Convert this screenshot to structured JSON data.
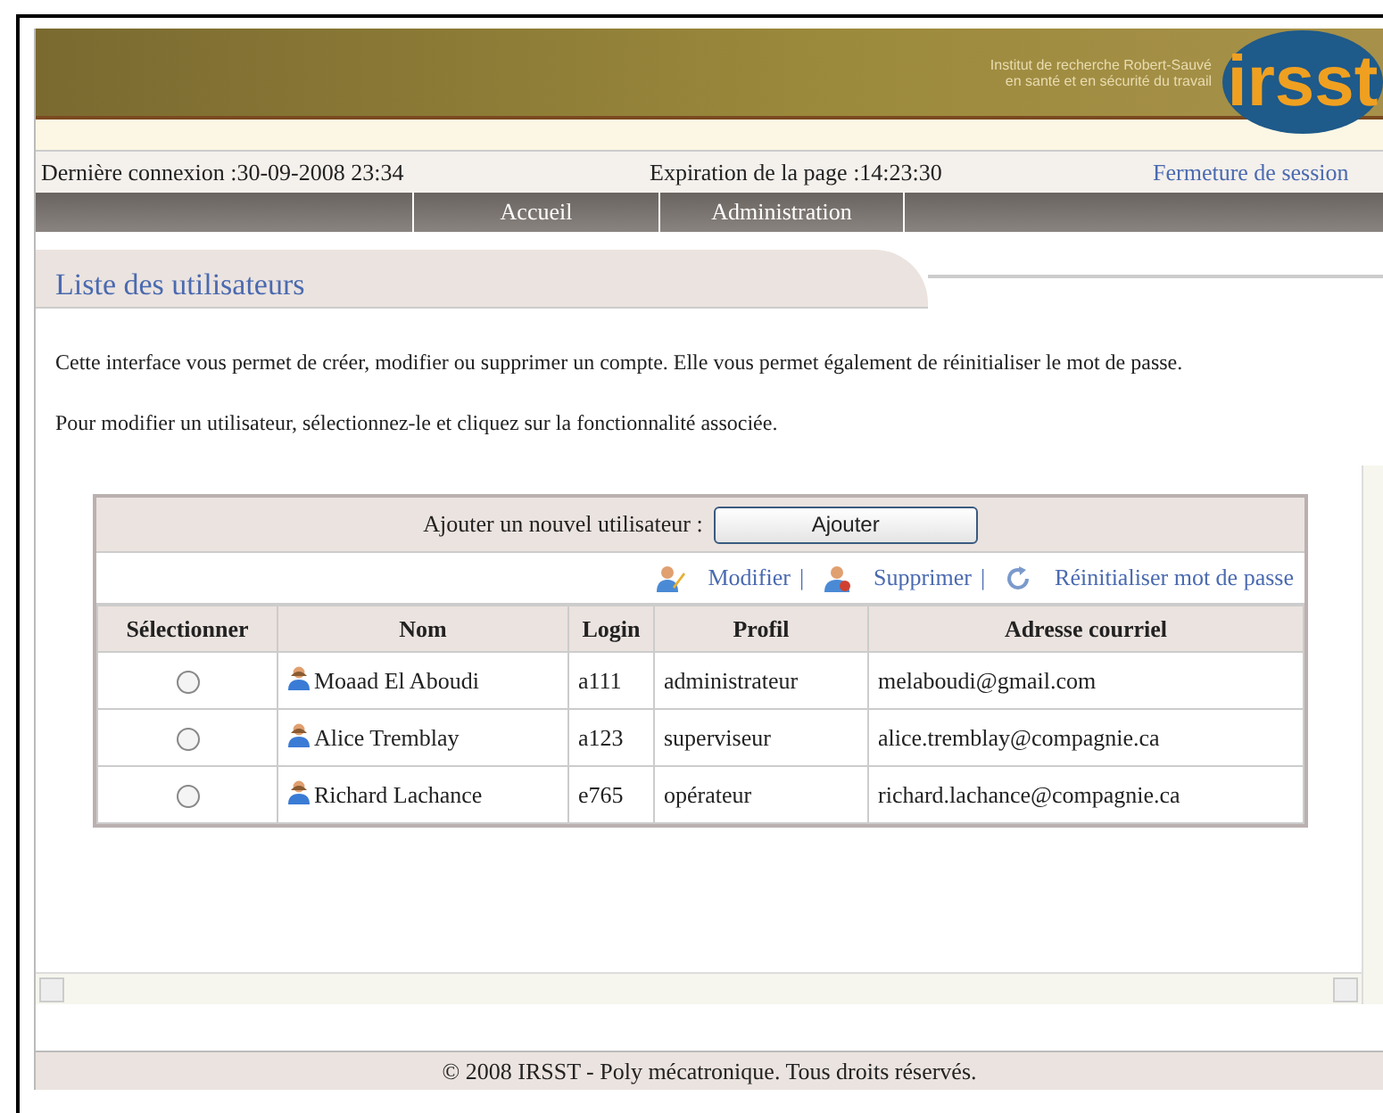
{
  "banner": {
    "institute_line_1": "Institut de recherche Robert-Sauvé",
    "institute_line_2": "en santé et en sécurité du travail",
    "logo": "irsst"
  },
  "info_bar": {
    "last_login": "Dernière connexion :30-09-2008 23:34",
    "expiration": "Expiration de la page :14:23:30",
    "logout": "Fermeture de session"
  },
  "nav": [
    {
      "label": "Accueil",
      "selected": false
    },
    {
      "label": "Administration",
      "selected": false
    }
  ],
  "page_title": "Liste des utilisateurs",
  "paragraphs": [
    "Cette interface vous permet de créer, modifier ou supprimer un compte. Elle vous permet également de réinitialiser le mot de passe.",
    "Pour modifier un utilisateur, sélectionnez-le et cliquez sur la fonctionnalité associée."
  ],
  "add_row": {
    "label": "Ajouter un nouvel utilisateur :",
    "button": "Ajouter"
  },
  "actions": [
    {
      "kind": "edit",
      "label": "Modifier"
    },
    {
      "kind": "delete",
      "separator": "|",
      "label": "Supprimer"
    },
    {
      "kind": "reset",
      "separator": "|",
      "label": "Réinitialiser mot de passe"
    }
  ],
  "table": {
    "columns": [
      "Sélectionner",
      "Nom",
      "Login",
      "Profil",
      "Adresse courriel"
    ],
    "rows": [
      {
        "selected": false,
        "name": "Moaad El Aboudi",
        "login": "a111",
        "profile": "administrateur",
        "email": "melaboudi@gmail.com"
      },
      {
        "selected": false,
        "name": "Alice Tremblay",
        "login": "a123",
        "profile": "superviseur",
        "email": "alice.tremblay@compagnie.ca"
      },
      {
        "selected": false,
        "name": "Richard Lachance",
        "login": "e765",
        "profile": "opérateur",
        "email": "richard.lachance@compagnie.ca"
      }
    ]
  },
  "footer": "© 2008 IRSST - Poly mécatronique. Tous droits réservés."
}
